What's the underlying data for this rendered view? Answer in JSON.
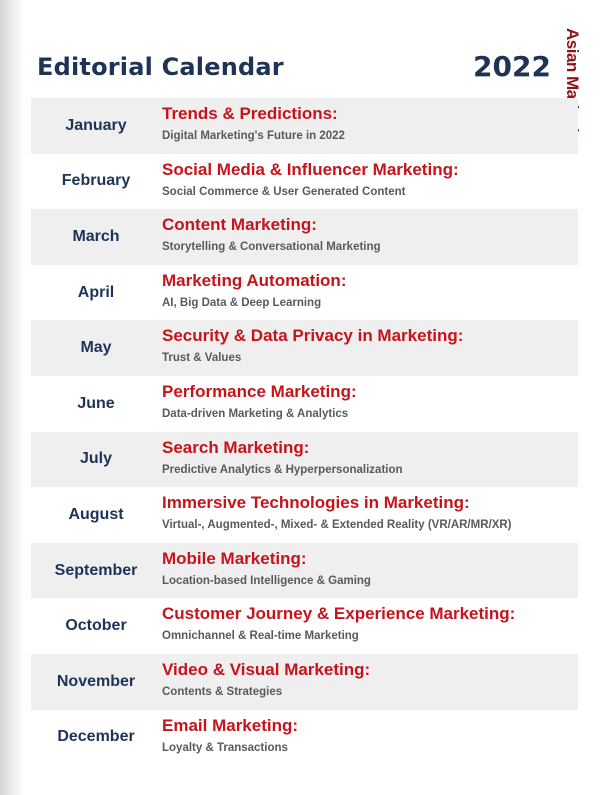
{
  "header": {
    "title": "Editorial Calendar",
    "year": "2022",
    "logo_text": "Asian Marketing",
    "brand_color": "#8e1518"
  },
  "colors": {
    "heading": "#1e3356",
    "topic": "#c5141b",
    "subtopic": "#5a5a5a",
    "row_shade": "#efefef"
  },
  "months": [
    {
      "month": "January",
      "topic": "Trends & Predictions:",
      "sub": "Digital Marketing's Future in 2022"
    },
    {
      "month": "February",
      "topic": "Social Media & Influencer Marketing:",
      "sub": "Social Commerce & User Generated Content"
    },
    {
      "month": "March",
      "topic": "Content Marketing:",
      "sub": "Storytelling & Conversational Marketing"
    },
    {
      "month": "April",
      "topic": "Marketing Automation:",
      "sub": "AI, Big Data & Deep Learning"
    },
    {
      "month": "May",
      "topic": "Security & Data Privacy in Marketing:",
      "sub": "Trust & Values"
    },
    {
      "month": "June",
      "topic": "Performance Marketing:",
      "sub": "Data-driven Marketing & Analytics"
    },
    {
      "month": "July",
      "topic": "Search Marketing:",
      "sub": "Predictive Analytics & Hyperpersonalization"
    },
    {
      "month": "August",
      "topic": "Immersive Technologies in Marketing:",
      "sub": "Virtual-, Augmented-, Mixed- & Extended Reality (VR/AR/MR/XR)"
    },
    {
      "month": "September",
      "topic": "Mobile Marketing:",
      "sub": "Location-based Intelligence & Gaming"
    },
    {
      "month": "October",
      "topic": "Customer Journey & Experience Marketing:",
      "sub": "Omnichannel & Real-time Marketing"
    },
    {
      "month": "November",
      "topic": "Video & Visual Marketing:",
      "sub": "Contents & Strategies"
    },
    {
      "month": "December",
      "topic": "Email Marketing:",
      "sub": "Loyalty & Transactions"
    }
  ]
}
